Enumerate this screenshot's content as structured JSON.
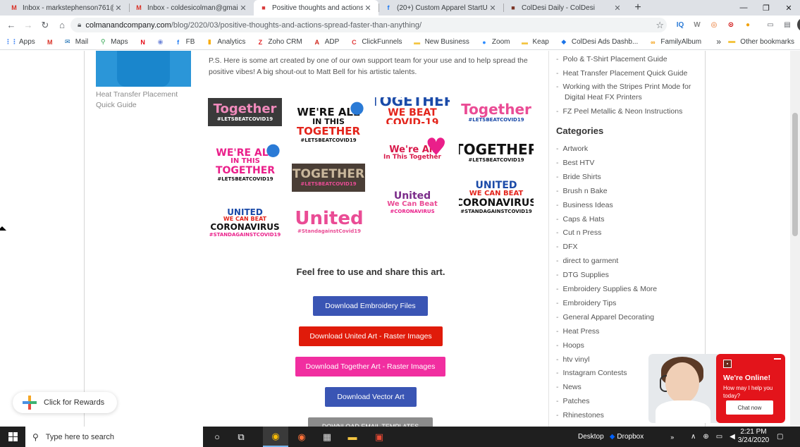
{
  "browser": {
    "tabs": [
      {
        "title": "Inbox - markstephenson761@gm",
        "icon": "gmail-icon",
        "color": "#d93025",
        "glyph": "M",
        "active": false
      },
      {
        "title": "Inbox - coldesicolman@gmail.co",
        "icon": "gmail-icon",
        "color": "#d93025",
        "glyph": "M",
        "active": false
      },
      {
        "title": "Positive thoughts and actions spr",
        "icon": "site-icon",
        "color": "#d93b3b",
        "glyph": "■",
        "active": true
      },
      {
        "title": "(20+) Custom Apparel StartUps",
        "icon": "facebook-icon",
        "color": "#1877f2",
        "glyph": "f",
        "active": false
      },
      {
        "title": "ColDesi Daily - ColDesi",
        "icon": "coldesi-icon",
        "color": "#7a3324",
        "glyph": "■",
        "active": false
      }
    ],
    "new_tab": "+",
    "window": {
      "minimize": "—",
      "maximize": "❐",
      "close": "✕"
    },
    "url_host": "colmanandcompany.com",
    "url_path": "/blog/2020/03/positive-thoughts-and-actions-spread-faster-than-anything/",
    "bookmarks": [
      {
        "label": "Apps",
        "icon": "apps-grid-icon",
        "color": "#4285f4",
        "glyph": "⋮⋮"
      },
      {
        "label": "",
        "icon": "gmail-icon",
        "color": "#d93025",
        "glyph": "M"
      },
      {
        "label": "Mail",
        "icon": "outlook-icon",
        "color": "#0a64ad",
        "glyph": "✉"
      },
      {
        "label": "Maps",
        "icon": "maps-icon",
        "color": "#34a853",
        "glyph": "⚲"
      },
      {
        "label": "",
        "icon": "netflix-icon",
        "color": "#e50914",
        "glyph": "N"
      },
      {
        "label": "",
        "icon": "discord-icon",
        "color": "#7289da",
        "glyph": "◉"
      },
      {
        "label": "FB",
        "icon": "facebook-icon",
        "color": "#1877f2",
        "glyph": "f"
      },
      {
        "label": "Analytics",
        "icon": "analytics-icon",
        "color": "#f9ab00",
        "glyph": "▮"
      },
      {
        "label": "Zoho CRM",
        "icon": "zoho-icon",
        "color": "#e42527",
        "glyph": "Z"
      },
      {
        "label": "ADP",
        "icon": "adp-icon",
        "color": "#d0271d",
        "glyph": "A"
      },
      {
        "label": "ClickFunnels",
        "icon": "clickfunnels-icon",
        "color": "#e23a3a",
        "glyph": "C"
      },
      {
        "label": "New Business",
        "icon": "folder-icon",
        "color": "#f4c542",
        "glyph": "▬"
      },
      {
        "label": "Zoom",
        "icon": "zoom-icon",
        "color": "#2d8cff",
        "glyph": "●"
      },
      {
        "label": "Keap",
        "icon": "folder-icon",
        "color": "#f4c542",
        "glyph": "▬"
      },
      {
        "label": "ColDesi Ads Dashb...",
        "icon": "dashboard-icon",
        "color": "#1a73e8",
        "glyph": "◆"
      },
      {
        "label": "FamilyAlbum",
        "icon": "familyalbum-icon",
        "color": "#f39800",
        "glyph": "∞"
      }
    ],
    "bookmarks_more": "»",
    "other_bookmarks": "Other bookmarks"
  },
  "page": {
    "left_caption": "Heat Transfer Placement Quick Guide",
    "ps_text": "P.S. Here is some art created by one of our own support team for your use and to help spread the positive vibes! A big shout-out to Matt Bell for his artistic talents.",
    "art": [
      {
        "line1": "Together",
        "tag": "#LETSBEATCOVID19"
      },
      {
        "line1": "WE'RE ALL",
        "line2": "IN THIS",
        "line3": "TOGETHER",
        "tag": "#LETSBEATCOVID19"
      },
      {
        "line1": "TOGETHER",
        "line2": "WE BEAT COVID-19"
      },
      {
        "line1": "Together",
        "tag": "#LETSBEATCOVID19"
      },
      {
        "line1": "WE'RE ALL",
        "line2": "IN THIS",
        "line3": "TOGETHER",
        "tag": "#LETSBEATCOVID19"
      },
      {
        "line1": "We're All",
        "line2": "In This Together"
      },
      {
        "line1": "TOGETHER",
        "tag": "#LETSBEATCOVID19"
      },
      {
        "line1": "TOGETHER",
        "tag": "#LETSBEATCOVID19"
      },
      {
        "line1": "United",
        "line2": "We Can Beat",
        "tag": "#CORONAVIRUS"
      },
      {
        "line1": "UNITED",
        "line2": "WE CAN BEAT",
        "line3": "CORONAVIRUS",
        "tag": "#STANDAGAINSTCOVID19"
      },
      {
        "line1": "UNITED",
        "line2": "WE CAN BEAT",
        "line3": "CORONAVIRUS",
        "tag": "#STANDAGAINSTCOVID19"
      },
      {
        "line1": "United",
        "tag": "#StandagainstCovid19"
      }
    ],
    "share_heading": "Feel free to use and share this art.",
    "buttons": [
      {
        "label": "Download Embroidery Files",
        "color": "#3a55b4"
      },
      {
        "label": "Download United Art - Raster Images",
        "color": "#e01b0a"
      },
      {
        "label": "Download Together Art - Raster Images",
        "color": "#f12ea0"
      },
      {
        "label": "Download Vector Art",
        "color": "#3a55b4"
      },
      {
        "label": "DOWNLOAD EMAIL TEMPLATES",
        "color": "#8c8c8c"
      }
    ]
  },
  "sidebar": {
    "guides": [
      "Polo & T-Shirt Placement Guide",
      "Heat Transfer Placement Quick Guide",
      "Working with the Stripes Print Mode for Digital Heat FX Printers",
      "FZ Peel Metallic & Neon Instructions"
    ],
    "categories_title": "Categories",
    "categories": [
      "Artwork",
      "Best HTV",
      "Bride Shirts",
      "Brush n Bake",
      "Business Ideas",
      "Caps & Hats",
      "Cut n Press",
      "DFX",
      "direct to garment",
      "DTG Supplies",
      "Embroidery Supplies & More",
      "Embroidery Tips",
      "General Apparel Decorating",
      "Heat Press",
      "Hoops",
      "htv vinyl",
      "Instagram Contests",
      "News",
      "Patches",
      "Rhinestones"
    ]
  },
  "rewards": {
    "label": "Click for Rewards"
  },
  "chat": {
    "heading": "We're Online!",
    "sub": "How may I help you today?",
    "cta": "Chat now"
  },
  "taskbar": {
    "search_placeholder": "Type here to search",
    "desktop": "Desktop",
    "dropbox": "Dropbox",
    "time": "2:21 PM",
    "date": "3/24/2020"
  }
}
